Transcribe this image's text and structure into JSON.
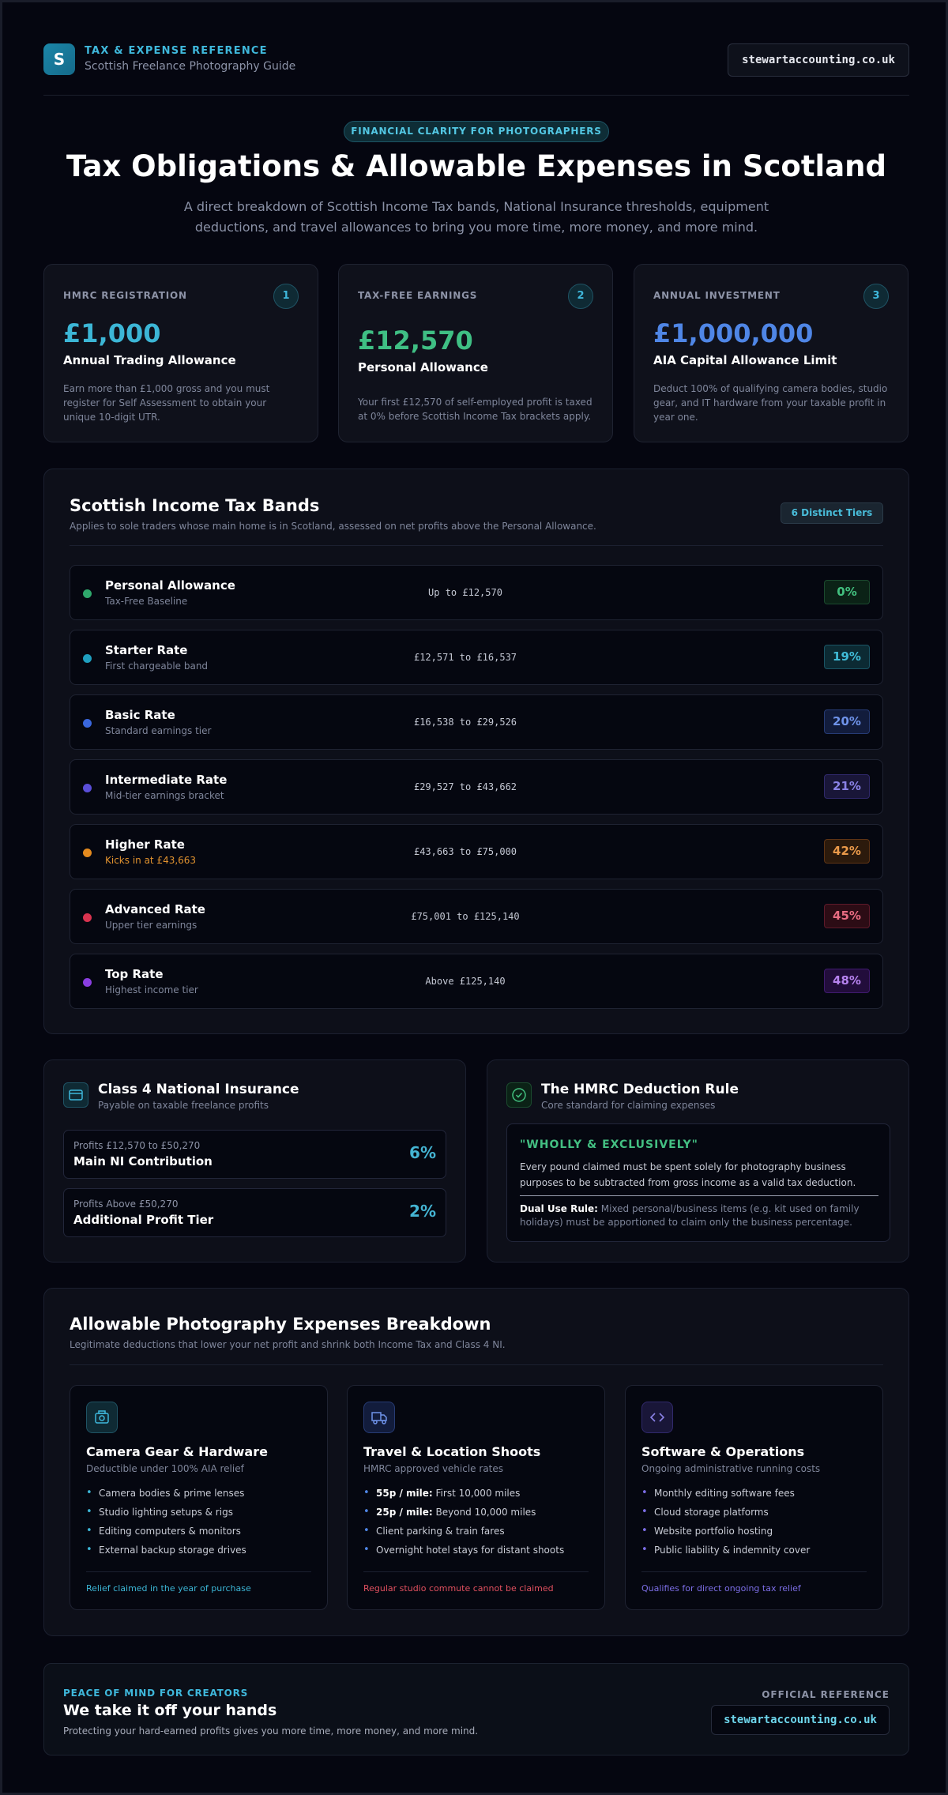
{
  "header": {
    "logo_letter": "S",
    "kicker": "TAX & EXPENSE REFERENCE",
    "subtitle": "Scottish Freelance Photography Guide",
    "site_button": "stewartaccounting.co.uk"
  },
  "hero": {
    "pill": "FINANCIAL CLARITY FOR PHOTOGRAPHERS",
    "title": "Tax Obligations & Allowable Expenses in Scotland",
    "subtitle": "A direct breakdown of Scottish Income Tax bands, National Insurance thresholds, equipment deductions, and travel allowances to bring you more time, more money, and more mind."
  },
  "stats": [
    {
      "label": "HMRC REGISTRATION",
      "num": "1",
      "value": "£1,000",
      "title": "Annual Trading Allowance",
      "desc": "Earn more than £1,000 gross and you must register for Self Assessment to obtain your unique 10-digit UTR.",
      "color": "#3cb6d6"
    },
    {
      "label": "TAX-FREE EARNINGS",
      "num": "2",
      "value": "£12,570",
      "title": "Personal Allowance",
      "desc": "Your first £12,570 of self-employed profit is taxed at 0% before Scottish Income Tax brackets apply.",
      "color": "#3fbf84"
    },
    {
      "label": "ANNUAL INVESTMENT",
      "num": "3",
      "value": "£1,000,000",
      "title": "AIA Capital Allowance Limit",
      "desc": "Deduct 100% of qualifying camera bodies, studio gear, and IT hardware from your taxable profit in year one.",
      "color": "#4f86e6"
    }
  ],
  "bands_panel": {
    "title": "Scottish Income Tax Bands",
    "subtitle": "Applies to sole traders whose main home is in Scotland, assessed on net profits above the Personal Allowance.",
    "badge": "6 Distinct Tiers",
    "bands": [
      {
        "name": "Personal Allowance",
        "sub": "Tax-Free Baseline",
        "range": "Up to £12,570",
        "rate": "0%",
        "dot": "#2fa86c",
        "rate_color": "#42c07f",
        "rate_bg": "#0b2216",
        "rate_border": "#1b4a2e",
        "sub_color": "#7f869b"
      },
      {
        "name": "Starter Rate",
        "sub": "First chargeable band",
        "range": "£12,571 to £16,537",
        "rate": "19%",
        "dot": "#1f9fbf",
        "rate_color": "#40bcd8",
        "rate_bg": "#0c2a33",
        "rate_border": "#1a5565",
        "sub_color": "#7f869b"
      },
      {
        "name": "Basic Rate",
        "sub": "Standard earnings tier",
        "range": "£16,538 to £29,526",
        "rate": "20%",
        "dot": "#3a67dd",
        "rate_color": "#6f93ea",
        "rate_bg": "#121c3c",
        "rate_border": "#263b74",
        "sub_color": "#7f869b"
      },
      {
        "name": "Intermediate Rate",
        "sub": "Mid-tier earnings bracket",
        "range": "£29,527 to £43,662",
        "rate": "21%",
        "dot": "#5a4ed8",
        "rate_color": "#8a82e6",
        "rate_bg": "#191638",
        "rate_border": "#30296b",
        "sub_color": "#7f869b"
      },
      {
        "name": "Higher Rate",
        "sub": "Kicks in at £43,663",
        "range": "£43,663 to £75,000",
        "rate": "42%",
        "dot": "#e48a1e",
        "rate_color": "#eb9a4a",
        "rate_bg": "#2c1a0c",
        "rate_border": "#5e3414",
        "sub_color": "#e0922f"
      },
      {
        "name": "Advanced Rate",
        "sub": "Upper tier earnings",
        "range": "£75,001 to £125,140",
        "rate": "45%",
        "dot": "#d8334f",
        "rate_color": "#e86c82",
        "rate_bg": "#2c0c15",
        "rate_border": "#5e1a2a",
        "sub_color": "#7f869b"
      },
      {
        "name": "Top Rate",
        "sub": "Highest income tier",
        "range": "Above £125,140",
        "rate": "48%",
        "dot": "#8a3ee0",
        "rate_color": "#b783ef",
        "rate_bg": "#220d3b",
        "rate_border": "#3f1a6e",
        "sub_color": "#7f869b"
      }
    ]
  },
  "ni": {
    "title": "Class 4 National Insurance",
    "subtitle": "Payable on taxable freelance profits",
    "rows": [
      {
        "small": "Profits £12,570 to £50,270",
        "big": "Main NI Contribution",
        "pct": "6%"
      },
      {
        "small": "Profits Above £50,270",
        "big": "Additional Profit Tier",
        "pct": "2%"
      }
    ]
  },
  "rule": {
    "title": "The HMRC Deduction Rule",
    "subtitle": "Core standard for claiming expenses",
    "kicker": "\"WHOLLY & EXCLUSIVELY\"",
    "text": "Every pound claimed must be spent solely for photography business purposes to be subtracted from gross income as a valid tax deduction.",
    "dual_label": "Dual Use Rule:",
    "dual_text": " Mixed personal/business items (e.g. kit used on family holidays) must be apportioned to claim only the business percentage."
  },
  "expenses_panel": {
    "title": "Allowable Photography Expenses Breakdown",
    "subtitle": "Legitimate deductions that lower your net profit and shrink both Income Tax and Class 4 NI.",
    "cards": [
      {
        "icon": "camera-icon",
        "title": "Camera Gear & Hardware",
        "sub": "Deductible under 100% AIA relief",
        "items": [
          {
            "bold": "",
            "text": "Camera bodies & prime lenses"
          },
          {
            "bold": "",
            "text": "Studio lighting setups & rigs"
          },
          {
            "bold": "",
            "text": "Editing computers & monitors"
          },
          {
            "bold": "",
            "text": "External backup storage drives"
          }
        ],
        "foot": "Relief claimed in the year of purchase",
        "accent": "#3cb6d6",
        "foot_color": "#3cb6d6"
      },
      {
        "icon": "truck-icon",
        "title": "Travel & Location Shoots",
        "sub": "HMRC approved vehicle rates",
        "items": [
          {
            "bold": "55p / mile:",
            "text": " First 10,000 miles"
          },
          {
            "bold": "25p / mile:",
            "text": " Beyond 10,000 miles"
          },
          {
            "bold": "",
            "text": "Client parking & train fares"
          },
          {
            "bold": "",
            "text": "Overnight hotel stays for distant shoots"
          }
        ],
        "foot": "Regular studio commute cannot be claimed",
        "accent": "#4f86e6",
        "foot_color": "#e0505f"
      },
      {
        "icon": "code-icon",
        "title": "Software & Operations",
        "sub": "Ongoing administrative running costs",
        "items": [
          {
            "bold": "",
            "text": "Monthly editing software fees"
          },
          {
            "bold": "",
            "text": "Cloud storage platforms"
          },
          {
            "bold": "",
            "text": "Website portfolio hosting"
          },
          {
            "bold": "",
            "text": "Public liability & indemnity cover"
          }
        ],
        "foot": "Qualifies for direct ongoing tax relief",
        "accent": "#7c6ee6",
        "foot_color": "#7c6ee6"
      }
    ]
  },
  "footer": {
    "kicker": "PEACE OF MIND FOR CREATORS",
    "title": "We take it off your hands",
    "subtitle": "Protecting your hard-earned profits gives you more time, more money, and more mind.",
    "ref_label": "OFFICIAL REFERENCE",
    "button": "stewartaccounting.co.uk"
  }
}
